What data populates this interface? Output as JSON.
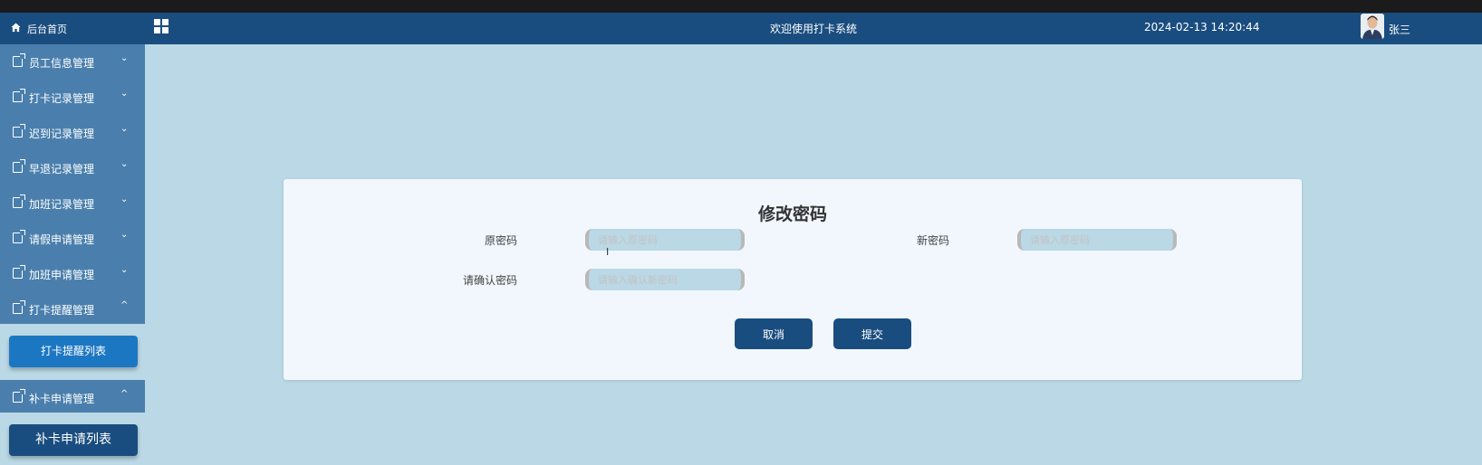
{
  "header": {
    "title": "欢迎使用打卡系统",
    "datetime": "2024-02-13 14:20:44",
    "username": "张三"
  },
  "sidebar": {
    "home_label": "后台首页",
    "items": [
      {
        "label": "员工信息管理",
        "chevron": "⌄"
      },
      {
        "label": "打卡记录管理",
        "chevron": "⌄"
      },
      {
        "label": "迟到记录管理",
        "chevron": "⌄"
      },
      {
        "label": "早退记录管理",
        "chevron": "⌄"
      },
      {
        "label": "加班记录管理",
        "chevron": "⌄"
      },
      {
        "label": "请假申请管理",
        "chevron": "⌄"
      },
      {
        "label": "加班申请管理",
        "chevron": "⌄"
      },
      {
        "label": "打卡提醒管理",
        "chevron": "^"
      },
      {
        "label": "补卡申请管理",
        "chevron": "^"
      }
    ],
    "subitems": {
      "reminder_list": "打卡提醒列表",
      "makeup_list": "补卡申请列表"
    }
  },
  "form": {
    "title": "修改密码",
    "old_password_label": "原密码",
    "old_password_placeholder": "请输入原密码",
    "new_password_label": "新密码",
    "new_password_placeholder": "请输入原密码",
    "confirm_password_label": "请确认密码",
    "confirm_password_placeholder": "请输入确认新密码",
    "cancel_label": "取消",
    "submit_label": "提交"
  },
  "colors": {
    "header_bg": "#1a4d7f",
    "sidebar_bg": "#4a7fad",
    "page_bg": "#bad8e5",
    "card_bg": "#f1f7fd",
    "active_sub_button": "#1c77c3"
  },
  "icons": {
    "menu": "grid-icon",
    "home": "home-icon",
    "menu_item": "document-edit-icon"
  }
}
